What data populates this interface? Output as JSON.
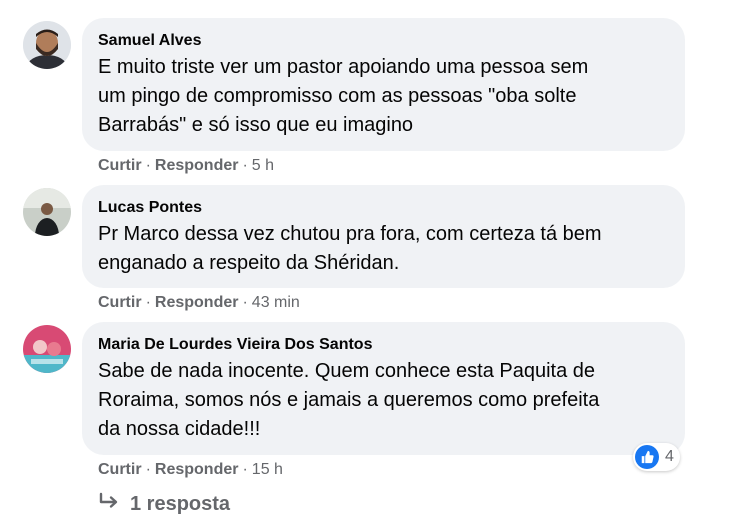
{
  "comments": [
    {
      "author": "Samuel Alves",
      "text_lines": [
        "E muito triste ver um pastor apoiando uma pessoa sem",
        "um pingo de compromisso com as pessoas \"oba solte",
        "Barrabás\" e só isso que eu imagino"
      ],
      "like_label": "Curtir",
      "reply_label": "Responder",
      "time": "5 h"
    },
    {
      "author": "Lucas Pontes",
      "text_lines": [
        "Pr Marco dessa vez chutou pra fora, com certeza tá bem",
        "enganado a respeito da Shéridan."
      ],
      "like_label": "Curtir",
      "reply_label": "Responder",
      "time": "43 min"
    },
    {
      "author": "Maria De Lourdes Vieira Dos Santos",
      "text_lines": [
        "Sabe de nada inocente. Quem conhece esta Paquita de",
        "Roraima, somos nós e jamais a queremos como prefeita",
        "da nossa cidade!!!"
      ],
      "like_label": "Curtir",
      "reply_label": "Responder",
      "time": "15 h",
      "reaction_count": "4"
    }
  ],
  "replies_label": "1 resposta",
  "separator": "·",
  "colors": {
    "bubble": "#f0f2f5",
    "meta": "#65676b",
    "like_blue": "#1877f2"
  },
  "icons": [
    "avatar-samuel",
    "avatar-lucas",
    "avatar-maria",
    "like-icon",
    "reply-arrow-icon"
  ]
}
